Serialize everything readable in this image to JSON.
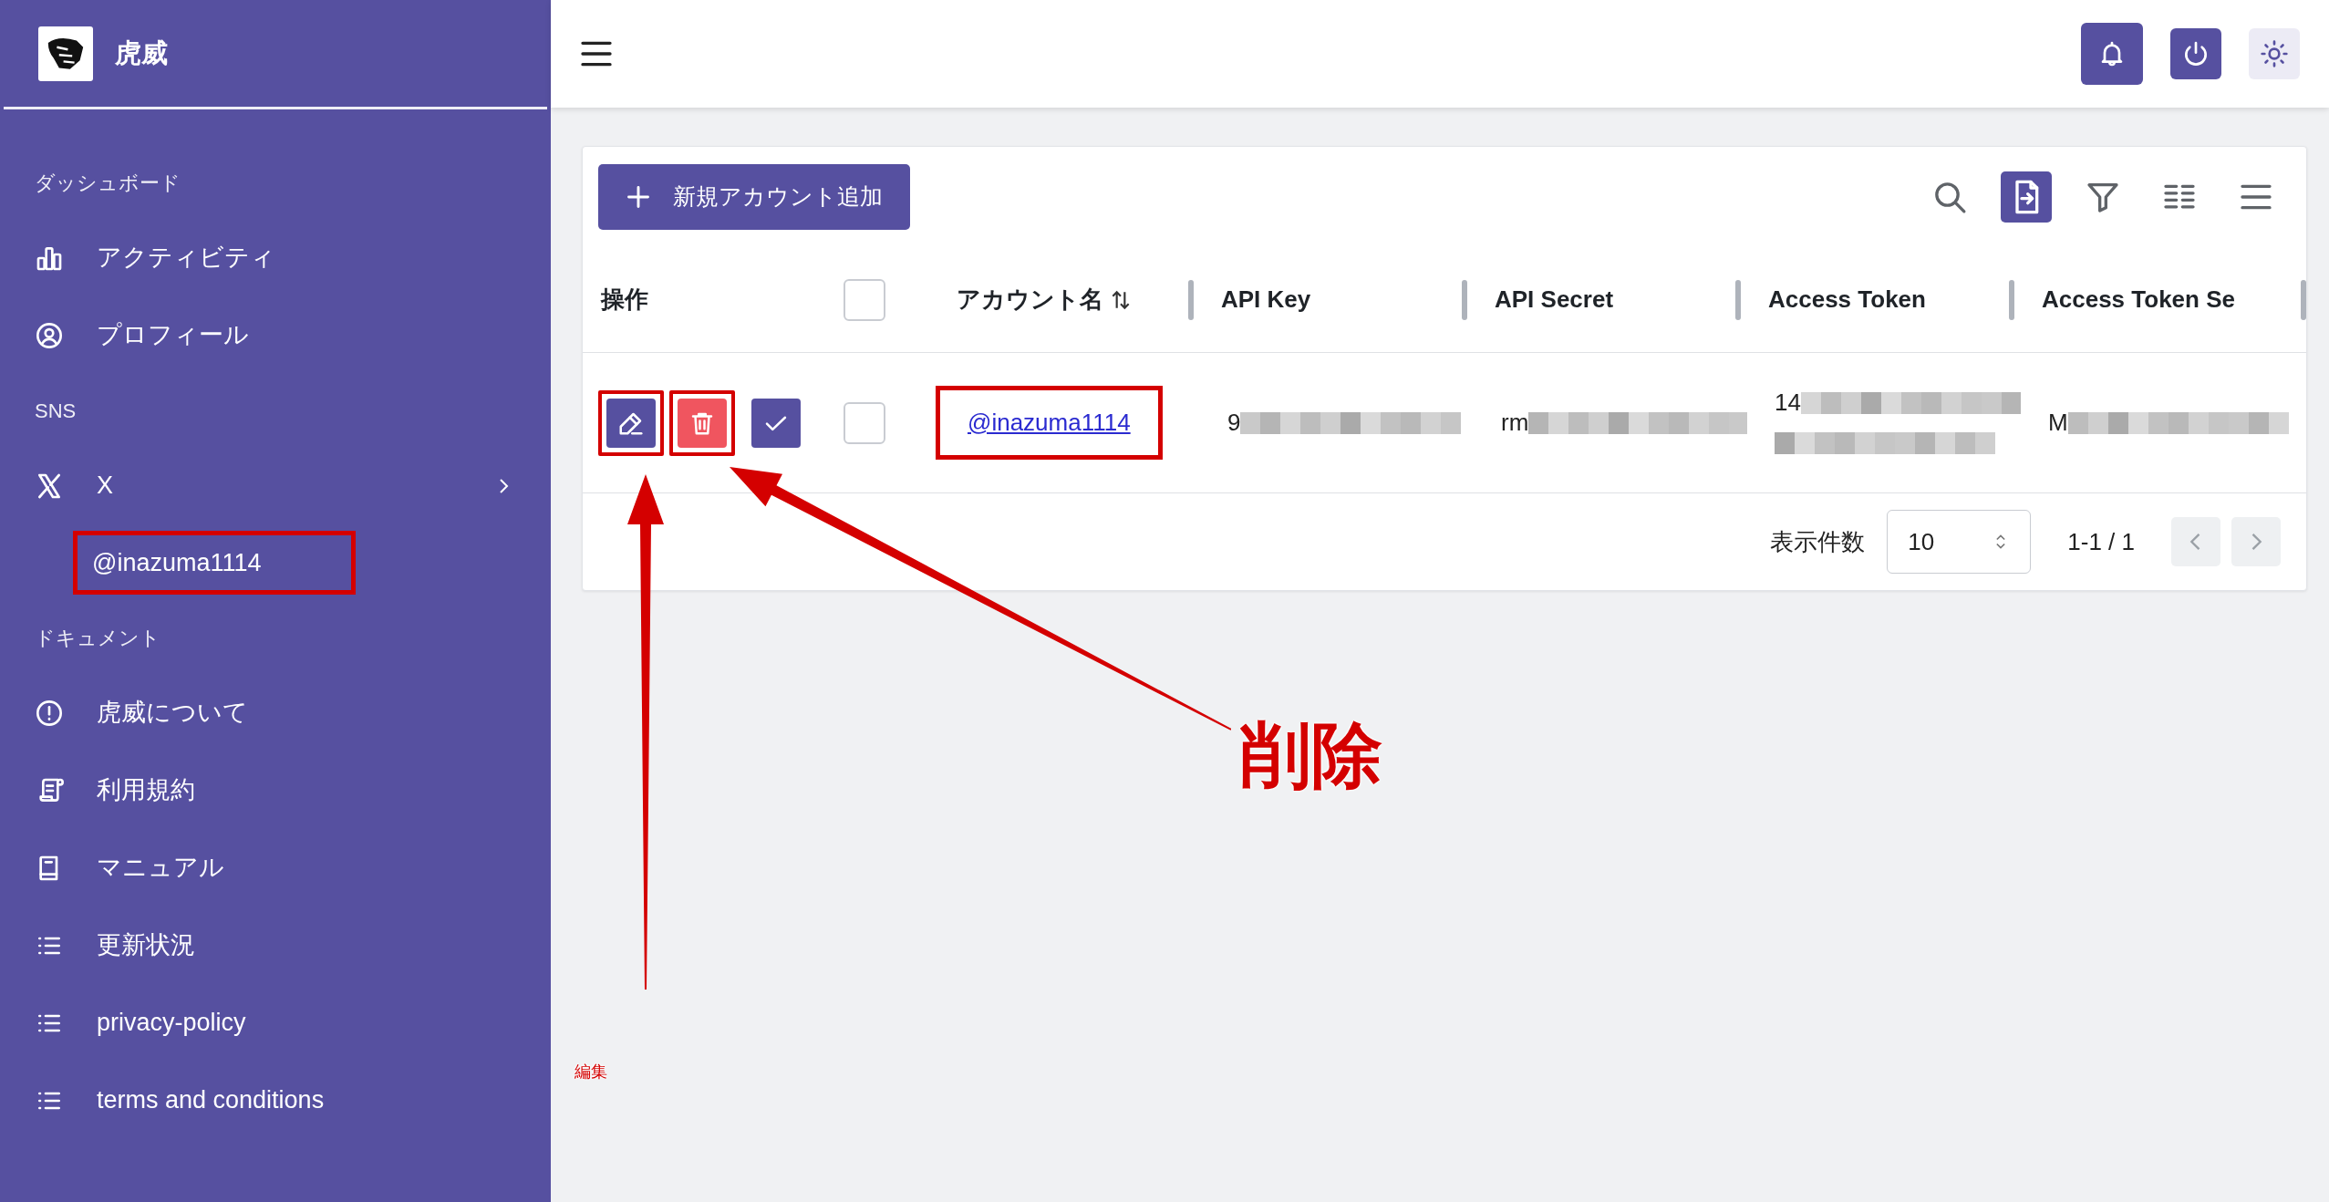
{
  "app": {
    "title": "虎威"
  },
  "sidebar": {
    "sections": [
      {
        "label": "ダッシュボード",
        "items": [
          {
            "label": "アクティビティ",
            "kind": "chart"
          },
          {
            "label": "プロフィール",
            "kind": "user"
          }
        ]
      },
      {
        "label": "SNS",
        "items": [
          {
            "label": "X",
            "kind": "x",
            "children": [
              {
                "label": "@inazuma1114",
                "highlighted": true
              }
            ]
          }
        ]
      },
      {
        "label": "ドキュメント",
        "items": [
          {
            "label": "虎威について",
            "kind": "info"
          },
          {
            "label": "利用規約",
            "kind": "scroll"
          },
          {
            "label": "マニュアル",
            "kind": "book"
          },
          {
            "label": "更新状況",
            "kind": "list"
          },
          {
            "label": "privacy-policy",
            "kind": "list"
          },
          {
            "label": "terms and conditions",
            "kind": "list"
          }
        ]
      }
    ]
  },
  "top_bar": {
    "buttons": [
      {
        "kind": "bell"
      },
      {
        "kind": "power"
      },
      {
        "kind": "sun"
      }
    ]
  },
  "toolbar": {
    "add_button": "新規アカウント追加",
    "tools": [
      {
        "kind": "search",
        "selected": false
      },
      {
        "kind": "export",
        "selected": true
      },
      {
        "kind": "filter",
        "selected": false
      },
      {
        "kind": "columns",
        "selected": false
      },
      {
        "kind": "menu",
        "selected": false
      }
    ]
  },
  "table": {
    "columns": [
      {
        "kind": "text",
        "label": "操作"
      },
      {
        "kind": "checkbox",
        "checked": false
      },
      {
        "kind": "text",
        "label": "アカウント名",
        "sortable": true
      },
      {
        "kind": "text",
        "label": "API Key"
      },
      {
        "kind": "text",
        "label": "API Secret"
      },
      {
        "kind": "text",
        "label": "Access Token"
      },
      {
        "kind": "text",
        "label": "Access Token Se"
      }
    ],
    "rows": [
      {
        "checked": false,
        "actions": [
          {
            "kind": "edit",
            "highlighted": true
          },
          {
            "kind": "delete",
            "highlighted": true
          },
          {
            "kind": "confirm",
            "highlighted": false
          }
        ],
        "account": {
          "text": "@inazuma1114",
          "highlighted": true
        },
        "values": [
          {
            "visible": "9",
            "kind": "one_line"
          },
          {
            "visible": "rm",
            "kind": "one_line"
          },
          {
            "visible": "14",
            "kind": "two_line"
          },
          {
            "visible": "M",
            "kind": "one_line"
          }
        ]
      }
    ]
  },
  "pagination": {
    "label": "表示件数",
    "page_size": "10",
    "range": "1-1 / 1"
  },
  "annotations": [
    {
      "kind": "arrow",
      "label": "削除"
    },
    {
      "kind": "arrow",
      "label": "編集"
    }
  ]
}
